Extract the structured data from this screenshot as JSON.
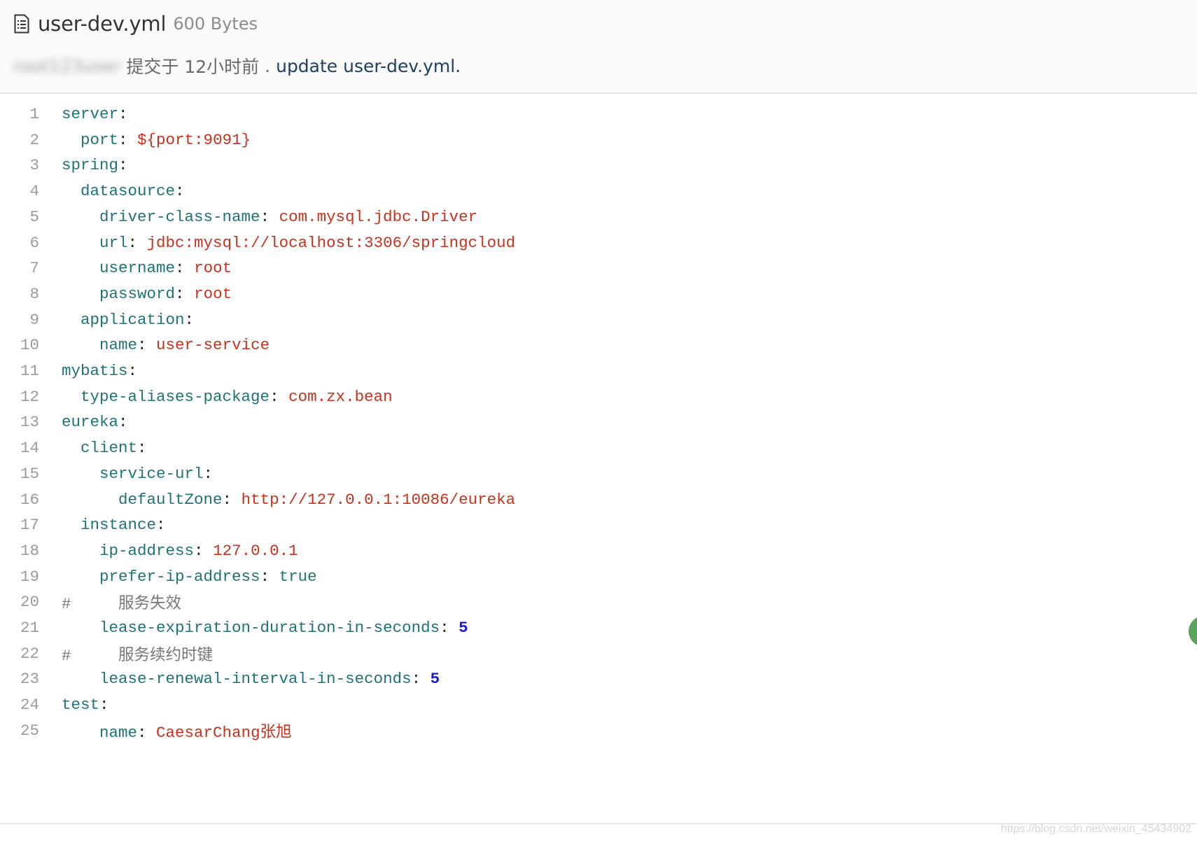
{
  "header": {
    "file_name": "user-dev.yml",
    "file_size": "600 Bytes",
    "commit_author": "root123user",
    "commit_time": "提交于 12小时前",
    "commit_separator": ".",
    "commit_message": "update user-dev.yml."
  },
  "colors": {
    "key": "#1f7374",
    "string": "#c8311d",
    "number": "#1a1ad0",
    "comment": "#777777",
    "line_number": "#9a9a9a"
  },
  "code": [
    {
      "n": "1",
      "indent": "",
      "key": "server",
      "sep": ":",
      "val": "",
      "vtype": ""
    },
    {
      "n": "2",
      "indent": "  ",
      "key": "port",
      "sep": ": ",
      "val": "${port:9091}",
      "vtype": "str"
    },
    {
      "n": "3",
      "indent": "",
      "key": "spring",
      "sep": ":",
      "val": "",
      "vtype": ""
    },
    {
      "n": "4",
      "indent": "  ",
      "key": "datasource",
      "sep": ":",
      "val": "",
      "vtype": ""
    },
    {
      "n": "5",
      "indent": "    ",
      "key": "driver-class-name",
      "sep": ": ",
      "val": "com.mysql.jdbc.Driver",
      "vtype": "str"
    },
    {
      "n": "6",
      "indent": "    ",
      "key": "url",
      "sep": ": ",
      "val": "jdbc:mysql://localhost:3306/springcloud",
      "vtype": "str"
    },
    {
      "n": "7",
      "indent": "    ",
      "key": "username",
      "sep": ": ",
      "val": "root",
      "vtype": "str"
    },
    {
      "n": "8",
      "indent": "    ",
      "key": "password",
      "sep": ": ",
      "val": "root",
      "vtype": "str"
    },
    {
      "n": "9",
      "indent": "  ",
      "key": "application",
      "sep": ":",
      "val": "",
      "vtype": ""
    },
    {
      "n": "10",
      "indent": "    ",
      "key": "name",
      "sep": ": ",
      "val": "user-service",
      "vtype": "str"
    },
    {
      "n": "11",
      "indent": "",
      "key": "mybatis",
      "sep": ":",
      "val": "",
      "vtype": ""
    },
    {
      "n": "12",
      "indent": "  ",
      "key": "type-aliases-package",
      "sep": ": ",
      "val": "com.zx.bean",
      "vtype": "str"
    },
    {
      "n": "13",
      "indent": "",
      "key": "eureka",
      "sep": ":",
      "val": "",
      "vtype": ""
    },
    {
      "n": "14",
      "indent": "  ",
      "key": "client",
      "sep": ":",
      "val": "",
      "vtype": ""
    },
    {
      "n": "15",
      "indent": "    ",
      "key": "service-url",
      "sep": ":",
      "val": "",
      "vtype": ""
    },
    {
      "n": "16",
      "indent": "      ",
      "key": "defaultZone",
      "sep": ": ",
      "val": "http://127.0.0.1:10086/eureka",
      "vtype": "str"
    },
    {
      "n": "17",
      "indent": "  ",
      "key": "instance",
      "sep": ":",
      "val": "",
      "vtype": ""
    },
    {
      "n": "18",
      "indent": "    ",
      "key": "ip-address",
      "sep": ": ",
      "val": "127.0.0.1",
      "vtype": "str"
    },
    {
      "n": "19",
      "indent": "    ",
      "key": "prefer-ip-address",
      "sep": ": ",
      "val": "true",
      "vtype": "bool"
    },
    {
      "n": "20",
      "indent": "",
      "key": "",
      "sep": "",
      "val": "#     服务失效",
      "vtype": "comment"
    },
    {
      "n": "21",
      "indent": "    ",
      "key": "lease-expiration-duration-in-seconds",
      "sep": ": ",
      "val": "5",
      "vtype": "num"
    },
    {
      "n": "22",
      "indent": "",
      "key": "",
      "sep": "",
      "val": "#     服务续约时键",
      "vtype": "comment"
    },
    {
      "n": "23",
      "indent": "    ",
      "key": "lease-renewal-interval-in-seconds",
      "sep": ": ",
      "val": "5",
      "vtype": "num"
    },
    {
      "n": "24",
      "indent": "",
      "key": "test",
      "sep": ":",
      "val": "",
      "vtype": ""
    },
    {
      "n": "25",
      "indent": "    ",
      "key": "name",
      "sep": ": ",
      "val": "CaesarChang张旭",
      "vtype": "str"
    }
  ],
  "watermark": "https://blog.csdn.net/weixin_45434902"
}
